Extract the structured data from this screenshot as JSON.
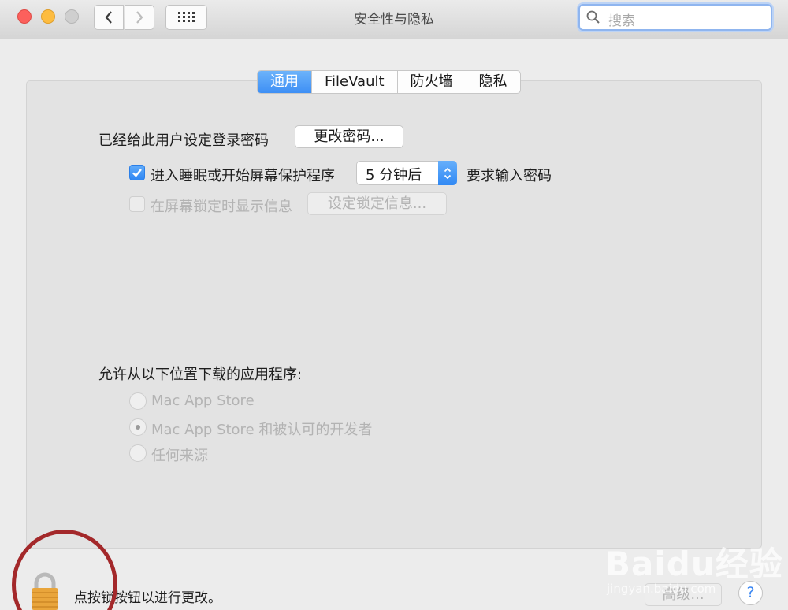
{
  "window": {
    "title": "安全性与隐私"
  },
  "search": {
    "placeholder": "搜索"
  },
  "tabs": [
    {
      "label": "通用",
      "active": true
    },
    {
      "label": "FileVault",
      "active": false
    },
    {
      "label": "防火墙",
      "active": false
    },
    {
      "label": "隐私",
      "active": false
    }
  ],
  "general": {
    "password_label": "已经给此用户设定登录密码",
    "change_password_button": "更改密码...",
    "require_password": {
      "checked": true,
      "label": "进入睡眠或开始屏幕保护程序",
      "delay_value": "5 分钟后",
      "suffix": "要求输入密码"
    },
    "lock_message": {
      "checked": false,
      "label": "在屏幕锁定时显示信息",
      "button": "设定锁定信息..."
    },
    "allow_apps": {
      "label": "允许从以下位置下载的应用程序:",
      "options": [
        {
          "label": "Mac App Store",
          "selected": false
        },
        {
          "label": "Mac App Store 和被认可的开发者",
          "selected": true
        },
        {
          "label": "任何来源",
          "selected": false
        }
      ]
    }
  },
  "footer": {
    "lock_text": "点按锁按钮以进行更改。",
    "advanced_button": "高级...",
    "help_button": "?"
  },
  "watermark": {
    "brand": "Baidu经验",
    "url": "jingyan.baidu.com"
  },
  "colors": {
    "accent": "#3e8ff5",
    "annotation_circle": "#a3282a"
  }
}
